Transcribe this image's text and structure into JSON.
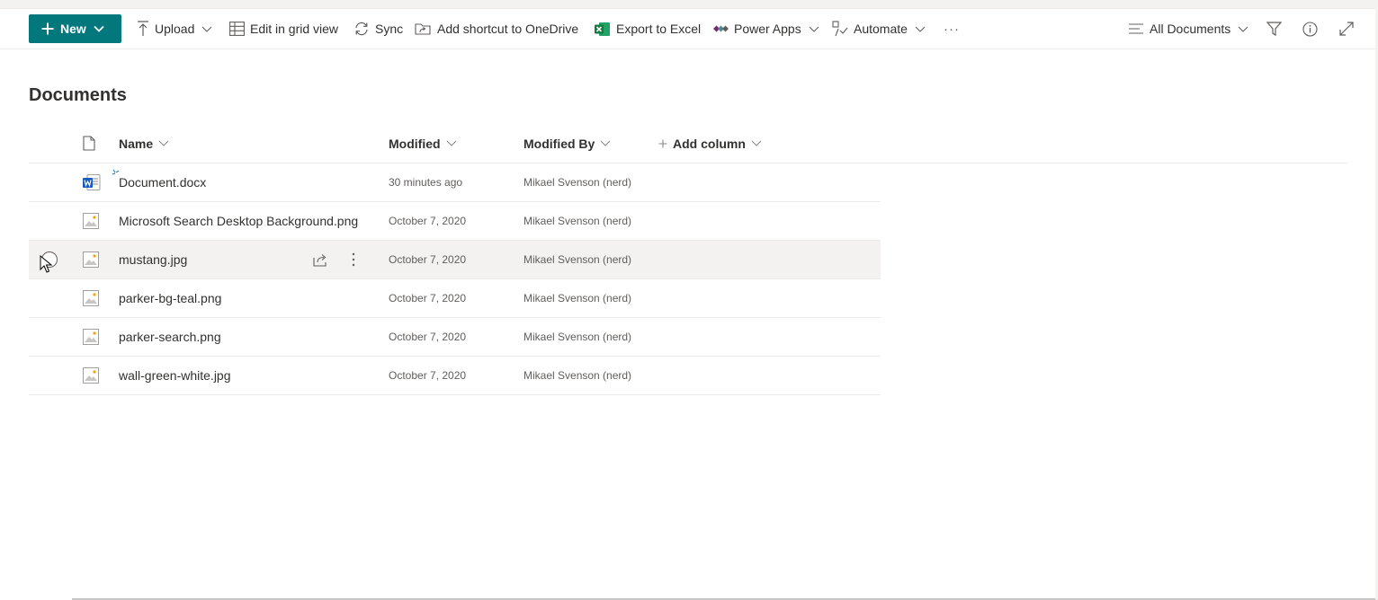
{
  "toolbar": {
    "new_label": "New",
    "upload_label": "Upload",
    "grid_label": "Edit in grid view",
    "sync_label": "Sync",
    "shortcut_label": "Add shortcut to OneDrive",
    "excel_label": "Export to Excel",
    "powerapps_label": "Power Apps",
    "automate_label": "Automate",
    "more_label": "···",
    "view_label": "All Documents"
  },
  "page": {
    "title": "Documents"
  },
  "columns": {
    "name": "Name",
    "modified": "Modified",
    "modified_by": "Modified By",
    "add_column": "Add column"
  },
  "files": [
    {
      "name": "Document.docx",
      "modified": "30 minutes ago",
      "modified_by": "Mikael Svenson (nerd)",
      "type": "word-icon"
    },
    {
      "name": "Microsoft Search Desktop Background.png",
      "modified": "October 7, 2020",
      "modified_by": "Mikael Svenson (nerd)",
      "type": "image-file-icon"
    },
    {
      "name": "mustang.jpg",
      "modified": "October 7, 2020",
      "modified_by": "Mikael Svenson (nerd)",
      "type": "image-file-icon"
    },
    {
      "name": "parker-bg-teal.png",
      "modified": "October 7, 2020",
      "modified_by": "Mikael Svenson (nerd)",
      "type": "image-file-icon"
    },
    {
      "name": "parker-search.png",
      "modified": "October 7, 2020",
      "modified_by": "Mikael Svenson (nerd)",
      "type": "image-file-icon"
    },
    {
      "name": "wall-green-white.jpg",
      "modified": "October 7, 2020",
      "modified_by": "Mikael Svenson (nerd)",
      "type": "image-file-icon"
    }
  ],
  "colors": {
    "accent": "#03787c",
    "hover_row": "#f3f2f1",
    "excel_green": "#107c41",
    "word_blue": "#185abd"
  }
}
